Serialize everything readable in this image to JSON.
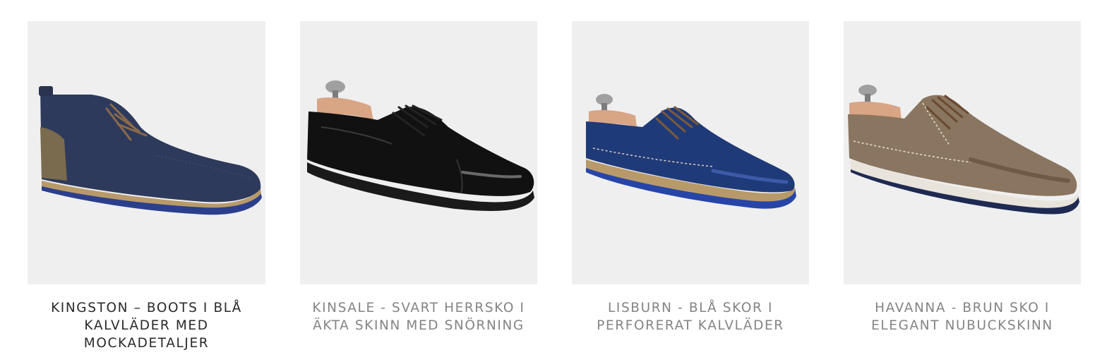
{
  "products": [
    {
      "name": "KINGSTON – BOOTS I BLÅ KALVLÄDER MED MOCKADETALJER",
      "image": "shoe-image-boot-blue",
      "colors": {
        "upper": "#2e3a5c",
        "accent": "#7a6a4e",
        "sole": "#2b3f8c",
        "welt": "#b89a6a"
      }
    },
    {
      "name": "KINSALE - SVART HERRSKO I ÄKTA SKINN MED SNÖRNING",
      "image": "shoe-image-derby-black",
      "colors": {
        "upper": "#111111",
        "accent": "#d8a585",
        "sole": "#1a1a1a",
        "welt": "#222222"
      }
    },
    {
      "name": "LISBURN - BLÅ SKOR I PERFORERAT KALVLÄDER",
      "image": "shoe-image-derby-blue",
      "colors": {
        "upper": "#1f3a78",
        "accent": "#d8a585",
        "sole": "#2745a8",
        "welt": "#b89a6a"
      }
    },
    {
      "name": "HAVANNA - BRUN SKO I ELEGANT NUBUCKSKINN",
      "image": "shoe-image-derby-brown",
      "colors": {
        "upper": "#8a7560",
        "accent": "#d8a585",
        "sole": "#1e2a52",
        "welt": "#e8e4dc"
      }
    }
  ]
}
